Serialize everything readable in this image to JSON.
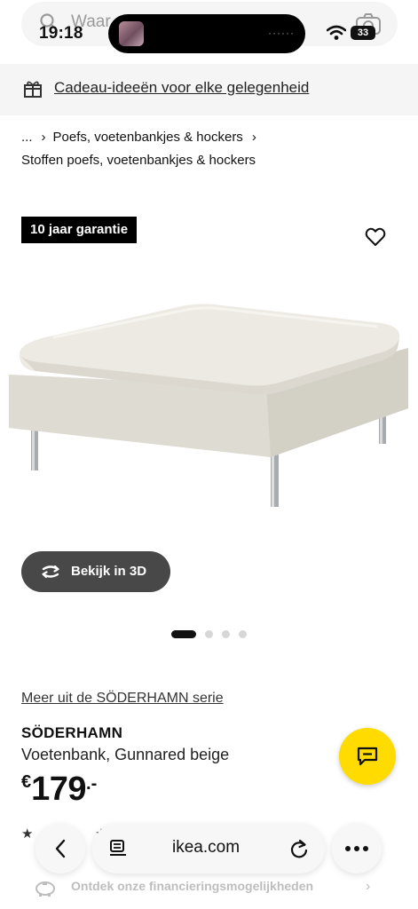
{
  "status_bar": {
    "time": "19:18",
    "battery": "33"
  },
  "search": {
    "placeholder": "Waar"
  },
  "gift_banner": {
    "text": "Cadeau-ideeën voor elke gelegenheid"
  },
  "breadcrumb": {
    "ellipsis": "...",
    "category": "Poefs, voetenbankjes & hockers",
    "current": "Stoffen poefs, voetenbankjes & hockers"
  },
  "product": {
    "badge": "10 jaar garantie",
    "view_3d": "Bekijk in 3D",
    "carousel": {
      "count": 4,
      "active": 0
    },
    "series_link": "Meer uit de SÖDERHAMN serie",
    "name": "SÖDERHAMN",
    "description": "Voetenbank, Gunnared beige",
    "price": {
      "currency": "€",
      "amount": "179",
      "decimals": ".-"
    },
    "rating_stars": "★ ★ ★ ★"
  },
  "browser": {
    "url": "ikea.com"
  },
  "financing": {
    "text": "Ontdek onze financieringsmogelijkheden"
  },
  "colors": {
    "accent_yellow": "#ffdb00",
    "badge_bg": "#000000",
    "button_dark": "#484848"
  }
}
